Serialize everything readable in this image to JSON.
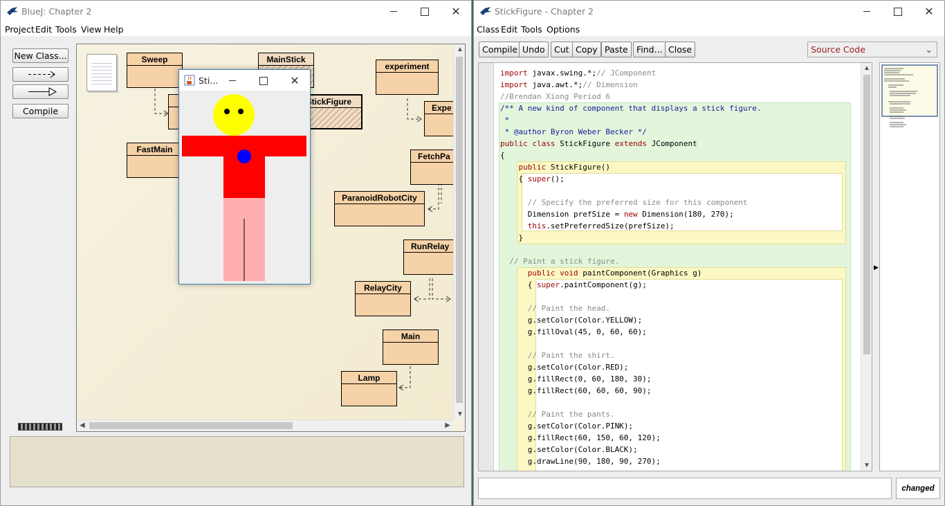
{
  "left_window": {
    "title": "BlueJ:  Chapter 2",
    "menu": [
      "Project",
      "Edit",
      "Tools",
      "View",
      "Help"
    ],
    "buttons": {
      "new_class": "New Class...",
      "uses_arrow": "- - ->",
      "inherit_arrow": "—▷",
      "compile": "Compile"
    },
    "classes": {
      "sweep": "Sweep",
      "mainstick": "MainStick",
      "stickfigure": "StickFigure",
      "experiment": "experiment",
      "expe": "Expe",
      "fastmain": "FastMain",
      "fetchpa": "FetchPa",
      "paranoid": "ParanoidRobotCity",
      "runrelay": "RunRelay",
      "relaycity": "RelayCity",
      "main": "Main",
      "lamp": "Lamp"
    }
  },
  "stick_window": {
    "title": "Sti..."
  },
  "right_window": {
    "title": "StickFigure - Chapter 2",
    "menu": [
      "Class",
      "Edit",
      "Tools",
      "Options"
    ],
    "toolbar": [
      "Compile",
      "Undo",
      "Cut",
      "Copy",
      "Paste",
      "Find...",
      "Close"
    ],
    "view_select": "Source Code",
    "status": "changed",
    "code": [
      "import javax.swing.*;// JComponent",
      "import java.awt.*;// Dimension",
      "//Brendan Xiong Period 6",
      "/** A new kind of component that displays a stick figure.",
      " *",
      " * @author Byron Weber Becker */",
      "public class StickFigure extends JComponent",
      "{",
      "    public StickFigure()",
      "    { super();",
      "",
      "      // Specify the preferred size for this component",
      "      Dimension prefSize = new Dimension(180, 270);",
      "      this.setPreferredSize(prefSize);",
      "    }",
      "",
      "  // Paint a stick figure.",
      "      public void paintComponent(Graphics g)",
      "      { super.paintComponent(g);",
      "",
      "      // Paint the head.",
      "      g.setColor(Color.YELLOW);",
      "      g.fillOval(45, 0, 60, 60);",
      "",
      "      // Paint the shirt.",
      "      g.setColor(Color.RED);",
      "      g.fillRect(0, 60, 180, 30);",
      "      g.fillRect(60, 60, 60, 90);",
      "",
      "      // Paint the pants.",
      "      g.setColor(Color.PINK);",
      "      g.fillRect(60, 150, 60, 120);",
      "      g.setColor(Color.BLACK);",
      "      g.drawLine(90, 180, 90, 270);"
    ]
  },
  "colors": {
    "head": "#ffff00",
    "shirt": "#ff0000",
    "pants": "#ffafaf",
    "eyes": "#000000",
    "button_dot": "#0000ff",
    "class_fill": "#f6d2a8",
    "editor_class_scope": "#e3f6dc",
    "editor_method_scope": "#fbf8c4"
  }
}
